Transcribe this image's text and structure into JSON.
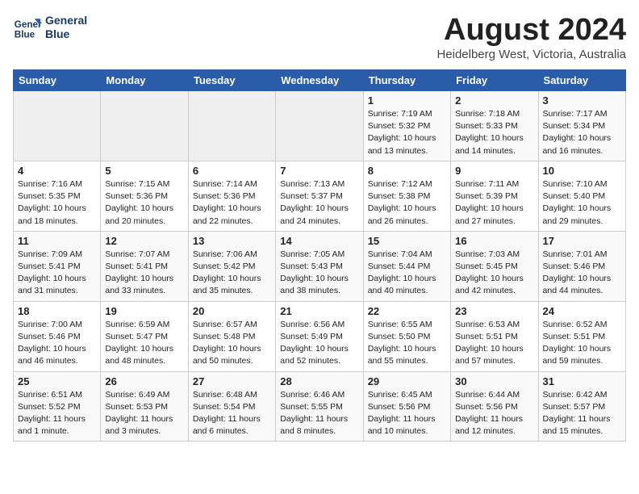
{
  "header": {
    "logo_line1": "General",
    "logo_line2": "Blue",
    "month": "August 2024",
    "location": "Heidelberg West, Victoria, Australia"
  },
  "weekdays": [
    "Sunday",
    "Monday",
    "Tuesday",
    "Wednesday",
    "Thursday",
    "Friday",
    "Saturday"
  ],
  "weeks": [
    [
      {
        "day": "",
        "info": ""
      },
      {
        "day": "",
        "info": ""
      },
      {
        "day": "",
        "info": ""
      },
      {
        "day": "",
        "info": ""
      },
      {
        "day": "1",
        "info": "Sunrise: 7:19 AM\nSunset: 5:32 PM\nDaylight: 10 hours\nand 13 minutes."
      },
      {
        "day": "2",
        "info": "Sunrise: 7:18 AM\nSunset: 5:33 PM\nDaylight: 10 hours\nand 14 minutes."
      },
      {
        "day": "3",
        "info": "Sunrise: 7:17 AM\nSunset: 5:34 PM\nDaylight: 10 hours\nand 16 minutes."
      }
    ],
    [
      {
        "day": "4",
        "info": "Sunrise: 7:16 AM\nSunset: 5:35 PM\nDaylight: 10 hours\nand 18 minutes."
      },
      {
        "day": "5",
        "info": "Sunrise: 7:15 AM\nSunset: 5:36 PM\nDaylight: 10 hours\nand 20 minutes."
      },
      {
        "day": "6",
        "info": "Sunrise: 7:14 AM\nSunset: 5:36 PM\nDaylight: 10 hours\nand 22 minutes."
      },
      {
        "day": "7",
        "info": "Sunrise: 7:13 AM\nSunset: 5:37 PM\nDaylight: 10 hours\nand 24 minutes."
      },
      {
        "day": "8",
        "info": "Sunrise: 7:12 AM\nSunset: 5:38 PM\nDaylight: 10 hours\nand 26 minutes."
      },
      {
        "day": "9",
        "info": "Sunrise: 7:11 AM\nSunset: 5:39 PM\nDaylight: 10 hours\nand 27 minutes."
      },
      {
        "day": "10",
        "info": "Sunrise: 7:10 AM\nSunset: 5:40 PM\nDaylight: 10 hours\nand 29 minutes."
      }
    ],
    [
      {
        "day": "11",
        "info": "Sunrise: 7:09 AM\nSunset: 5:41 PM\nDaylight: 10 hours\nand 31 minutes."
      },
      {
        "day": "12",
        "info": "Sunrise: 7:07 AM\nSunset: 5:41 PM\nDaylight: 10 hours\nand 33 minutes."
      },
      {
        "day": "13",
        "info": "Sunrise: 7:06 AM\nSunset: 5:42 PM\nDaylight: 10 hours\nand 35 minutes."
      },
      {
        "day": "14",
        "info": "Sunrise: 7:05 AM\nSunset: 5:43 PM\nDaylight: 10 hours\nand 38 minutes."
      },
      {
        "day": "15",
        "info": "Sunrise: 7:04 AM\nSunset: 5:44 PM\nDaylight: 10 hours\nand 40 minutes."
      },
      {
        "day": "16",
        "info": "Sunrise: 7:03 AM\nSunset: 5:45 PM\nDaylight: 10 hours\nand 42 minutes."
      },
      {
        "day": "17",
        "info": "Sunrise: 7:01 AM\nSunset: 5:46 PM\nDaylight: 10 hours\nand 44 minutes."
      }
    ],
    [
      {
        "day": "18",
        "info": "Sunrise: 7:00 AM\nSunset: 5:46 PM\nDaylight: 10 hours\nand 46 minutes."
      },
      {
        "day": "19",
        "info": "Sunrise: 6:59 AM\nSunset: 5:47 PM\nDaylight: 10 hours\nand 48 minutes."
      },
      {
        "day": "20",
        "info": "Sunrise: 6:57 AM\nSunset: 5:48 PM\nDaylight: 10 hours\nand 50 minutes."
      },
      {
        "day": "21",
        "info": "Sunrise: 6:56 AM\nSunset: 5:49 PM\nDaylight: 10 hours\nand 52 minutes."
      },
      {
        "day": "22",
        "info": "Sunrise: 6:55 AM\nSunset: 5:50 PM\nDaylight: 10 hours\nand 55 minutes."
      },
      {
        "day": "23",
        "info": "Sunrise: 6:53 AM\nSunset: 5:51 PM\nDaylight: 10 hours\nand 57 minutes."
      },
      {
        "day": "24",
        "info": "Sunrise: 6:52 AM\nSunset: 5:51 PM\nDaylight: 10 hours\nand 59 minutes."
      }
    ],
    [
      {
        "day": "25",
        "info": "Sunrise: 6:51 AM\nSunset: 5:52 PM\nDaylight: 11 hours\nand 1 minute."
      },
      {
        "day": "26",
        "info": "Sunrise: 6:49 AM\nSunset: 5:53 PM\nDaylight: 11 hours\nand 3 minutes."
      },
      {
        "day": "27",
        "info": "Sunrise: 6:48 AM\nSunset: 5:54 PM\nDaylight: 11 hours\nand 6 minutes."
      },
      {
        "day": "28",
        "info": "Sunrise: 6:46 AM\nSunset: 5:55 PM\nDaylight: 11 hours\nand 8 minutes."
      },
      {
        "day": "29",
        "info": "Sunrise: 6:45 AM\nSunset: 5:56 PM\nDaylight: 11 hours\nand 10 minutes."
      },
      {
        "day": "30",
        "info": "Sunrise: 6:44 AM\nSunset: 5:56 PM\nDaylight: 11 hours\nand 12 minutes."
      },
      {
        "day": "31",
        "info": "Sunrise: 6:42 AM\nSunset: 5:57 PM\nDaylight: 11 hours\nand 15 minutes."
      }
    ]
  ]
}
